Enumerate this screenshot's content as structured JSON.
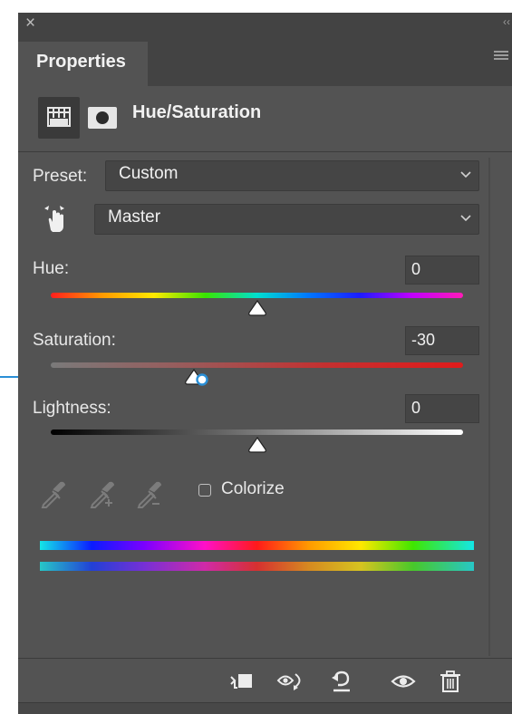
{
  "window": {
    "close_glyph": "×",
    "collapse_glyph": "‹‹"
  },
  "panel": {
    "tab_label": "Properties"
  },
  "adjustment": {
    "title": "Hue/Saturation"
  },
  "preset": {
    "label": "Preset:",
    "value": "Custom"
  },
  "channel": {
    "value": "Master"
  },
  "hue": {
    "label": "Hue:",
    "value": "0",
    "level_percent": 50
  },
  "saturation": {
    "label": "Saturation:",
    "value": "-30",
    "level_percent": 35
  },
  "lightness": {
    "label": "Lightness:",
    "value": "0",
    "level_percent": 50
  },
  "colorize": {
    "label": "Colorize",
    "checked": false
  },
  "icons": {
    "layer_thumbnail": "adjustment-layer-icon",
    "mask": "mask-icon",
    "targeted_adjustment": "hand-tool-icon",
    "eyedroppers": [
      "eyedropper-icon",
      "eyedropper-add-icon",
      "eyedropper-subtract-icon"
    ],
    "footer": [
      "clip-to-layer-icon",
      "view-previous-state-icon",
      "reset-icon",
      "visibility-eye-icon",
      "trash-icon"
    ]
  },
  "colors": {
    "panel_bg": "#535353",
    "header_bg": "#434343",
    "field_bg": "#454545",
    "callout": "#2a8fd6"
  }
}
